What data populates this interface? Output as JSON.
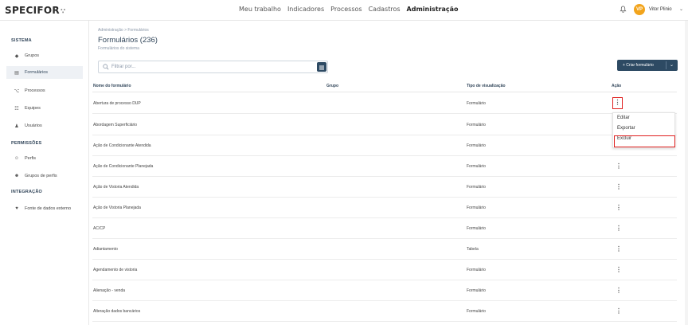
{
  "brand": {
    "name": "SPECIFOR",
    "dots": "∵"
  },
  "nav": {
    "items": [
      "Meu trabalho",
      "Indicadores",
      "Processos",
      "Cadastros",
      "Administração"
    ],
    "active": "Administração"
  },
  "user": {
    "initials": "VP",
    "name": "Vitor Plinio",
    "avatar_color": "#f2a41c"
  },
  "sidebar": {
    "sections": [
      {
        "title": "SISTEMA"
      },
      {
        "title": "PERMISSÕES"
      },
      {
        "title": "INTEGRAÇÃO"
      }
    ],
    "items": [
      {
        "label": "Grupos",
        "icon": "tag-icon"
      },
      {
        "label": "Formulários",
        "icon": "form-icon",
        "active": true
      },
      {
        "label": "Processos",
        "icon": "process-icon"
      },
      {
        "label": "Equipes",
        "icon": "team-icon"
      },
      {
        "label": "Usuários",
        "icon": "user-icon"
      },
      {
        "label": "Perfis",
        "icon": "profile-icon"
      },
      {
        "label": "Grupos de perfis",
        "icon": "profile-group-icon"
      },
      {
        "label": "Fonte de dados externo",
        "icon": "data-source-icon"
      }
    ]
  },
  "page": {
    "breadcrumb": "Administração  >  Formulários",
    "title": "Formulários (236)",
    "subtitle": "Formulários do sistema",
    "filter_placeholder": "Filtrar por...",
    "create_label": "+ Criar formulário"
  },
  "table": {
    "headers": [
      "Nome do formulário",
      "Grupo",
      "Tipo de visualização",
      "Ação"
    ],
    "rows": [
      {
        "name": "Abertura de processo DUP",
        "group": "",
        "view": "Formulário"
      },
      {
        "name": "Abordagem Superficiário",
        "group": "",
        "view": "Formulário"
      },
      {
        "name": "Ação de Condicionante Atendida",
        "group": "",
        "view": "Formulário"
      },
      {
        "name": "Ação de Condicionante Planejada",
        "group": "",
        "view": "Formulário"
      },
      {
        "name": "Ação de Vistoria Atendida",
        "group": "",
        "view": "Formulário"
      },
      {
        "name": "Ação de Vistoria Planejada",
        "group": "",
        "view": "Formulário"
      },
      {
        "name": "AC/CP",
        "group": "",
        "view": "Formulário"
      },
      {
        "name": "Adiantamento",
        "group": "",
        "view": "Tabela"
      },
      {
        "name": "Agendamento de vistoria",
        "group": "",
        "view": "Formulário"
      },
      {
        "name": "Alienação - venda",
        "group": "",
        "view": "Formulário"
      },
      {
        "name": "Alteração dados bancários",
        "group": "",
        "view": "Formulário"
      }
    ]
  },
  "action_menu": {
    "items": [
      "Editar",
      "Exportar",
      "Excluir"
    ]
  },
  "colors": {
    "primary": "#2d4a63",
    "highlight": "#e0201f",
    "accent": "#f2a41c"
  }
}
